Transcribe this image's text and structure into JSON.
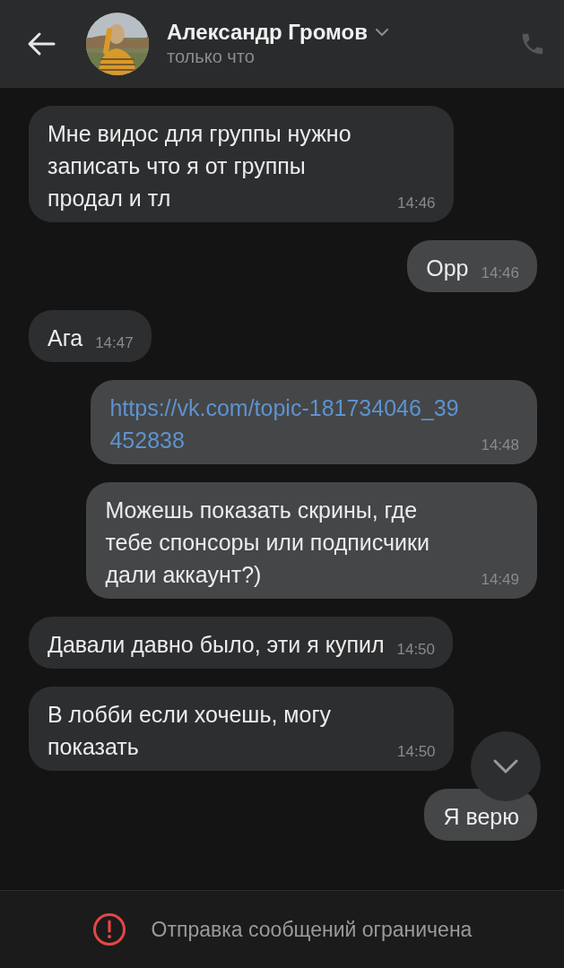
{
  "header": {
    "name": "Александр Громов",
    "status": "только что"
  },
  "messages": [
    {
      "outgoing": false,
      "kind": "text",
      "text": "Мне видос для группы нужно записать что я от группы продал и тл",
      "time": "14:46"
    },
    {
      "outgoing": true,
      "kind": "text",
      "text": "Орр",
      "time": "14:46"
    },
    {
      "outgoing": false,
      "kind": "text",
      "text": "Ага",
      "time": "14:47"
    },
    {
      "outgoing": true,
      "kind": "link",
      "text": "https://vk.com/topic-181734046_39452838",
      "time": "14:48"
    },
    {
      "outgoing": true,
      "kind": "text",
      "text": "Можешь показать скрины, где тебе спонсоры или подписчики дали аккаунт?)",
      "time": "14:49"
    },
    {
      "outgoing": false,
      "kind": "text",
      "text": "Давали давно было, эти я купил",
      "time": "14:50"
    },
    {
      "outgoing": false,
      "kind": "text",
      "text": "В лобби если хочешь, могу показать",
      "time": "14:50"
    },
    {
      "outgoing": true,
      "kind": "text",
      "text": "Я верю"
    }
  ],
  "footer": {
    "notice": "Отправка сообщений ограничена"
  }
}
